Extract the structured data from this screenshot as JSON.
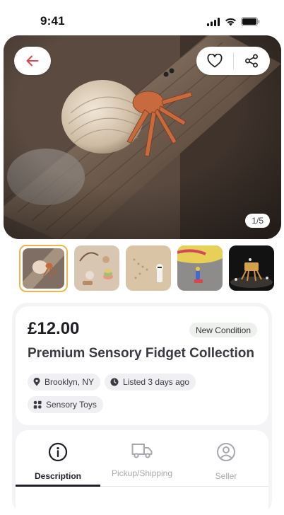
{
  "status_bar": {
    "time": "9:41",
    "icons": [
      "cellular-signal-icon",
      "wifi-icon",
      "battery-icon"
    ]
  },
  "gallery": {
    "counter": "1/5",
    "current_index": 1,
    "total": 5,
    "thumbnails": [
      {
        "name": "hermit-crab-photo",
        "selected": true
      },
      {
        "name": "wooden-toys-photo",
        "selected": false
      },
      {
        "name": "figurine-path-photo",
        "selected": false
      },
      {
        "name": "toy-on-carpet-photo",
        "selected": false
      },
      {
        "name": "robot-toy-photo",
        "selected": false
      }
    ]
  },
  "product": {
    "price": "£12.00",
    "condition": "New Condition",
    "title": "Premium Sensory Fidget Collection",
    "location": "Brooklyn, NY",
    "listed": "Listed 3 days ago",
    "category": "Sensory Toys"
  },
  "tabs": [
    {
      "label": "Description",
      "icon": "info-icon",
      "active": true
    },
    {
      "label": "Pickup/Shipping",
      "icon": "truck-icon",
      "active": false
    },
    {
      "label": "Seller",
      "icon": "user-icon",
      "active": false
    }
  ],
  "colors": {
    "back_arrow": "#e0474c",
    "thumb_selected_border": "#f0b54a",
    "primary_text": "#1f1f27",
    "muted_text": "#a8a8ae",
    "sheet_background": "#f4f4f6"
  }
}
